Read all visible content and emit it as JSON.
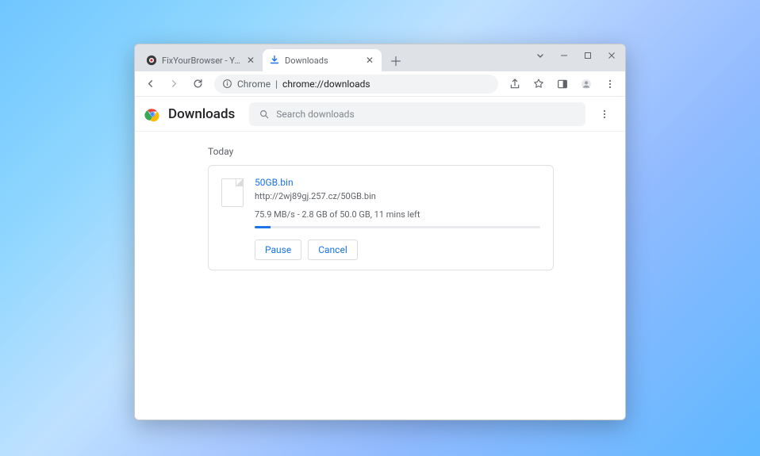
{
  "tabs": {
    "inactive": {
      "title": "FixYourBrowser - Your Trusted G..."
    },
    "active": {
      "title": "Downloads"
    }
  },
  "omnibox": {
    "prefix": "Chrome",
    "separator": " | ",
    "path": "chrome://downloads"
  },
  "page": {
    "title": "Downloads",
    "search_placeholder": "Search downloads",
    "section_label": "Today"
  },
  "download": {
    "filename": "50GB.bin",
    "source_url": "http://2wj89gj.257.cz/50GB.bin",
    "status": "75.9 MB/s - 2.8 GB of 50.0 GB, 11 mins left",
    "progress_percent": 5.6,
    "pause_label": "Pause",
    "cancel_label": "Cancel"
  }
}
